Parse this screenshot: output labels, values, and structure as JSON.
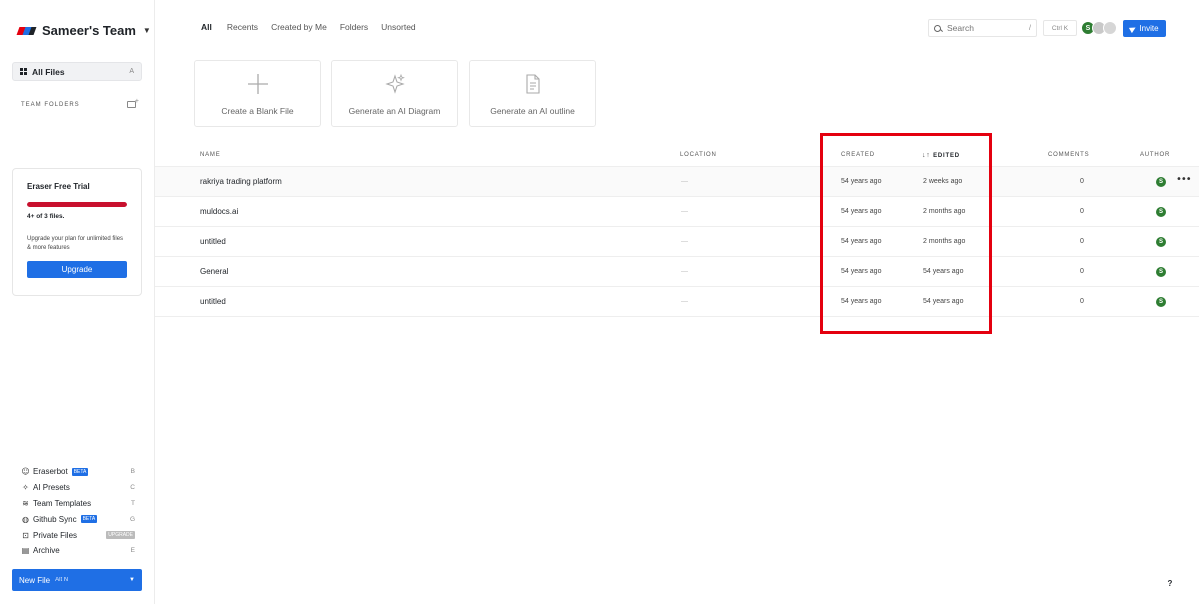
{
  "team": {
    "name": "Sameer's Team"
  },
  "sidebar": {
    "all_files": {
      "label": "All Files",
      "shortcut": "A"
    },
    "team_folders_label": "TEAM FOLDERS",
    "trial": {
      "title": "Eraser Free Trial",
      "usage_fraction": 1.0,
      "count_text": "4+ of 3 files.",
      "description": "Upgrade your plan for unlimited files & more features",
      "upgrade_label": "Upgrade"
    },
    "menu": [
      {
        "label": "Eraserbot",
        "badge": "BETA",
        "shortcut": "B",
        "icon": "robot-icon"
      },
      {
        "label": "AI Presets",
        "badge": "",
        "shortcut": "C",
        "icon": "sparkle-icon"
      },
      {
        "label": "Team Templates",
        "badge": "",
        "shortcut": "T",
        "icon": "layers-icon"
      },
      {
        "label": "Github Sync",
        "badge": "BETA",
        "shortcut": "G",
        "icon": "github-icon"
      },
      {
        "label": "Private Files",
        "badge": "UPGRADE",
        "shortcut": "",
        "icon": "lock-icon"
      },
      {
        "label": "Archive",
        "badge": "",
        "shortcut": "E",
        "icon": "archive-icon"
      }
    ],
    "new_file": {
      "label": "New File",
      "shortcut": "Alt N"
    }
  },
  "tabs": [
    {
      "label": "All",
      "active": true
    },
    {
      "label": "Recents",
      "active": false
    },
    {
      "label": "Created by Me",
      "active": false
    },
    {
      "label": "Folders",
      "active": false
    },
    {
      "label": "Unsorted",
      "active": false
    }
  ],
  "search": {
    "placeholder": "Search",
    "shortcut": "/"
  },
  "command_shortcut": "Ctrl K",
  "avatars": [
    {
      "initial": "S",
      "color": "#2e7d32"
    },
    {
      "initial": "",
      "color": "#c9c9c9"
    },
    {
      "initial": "",
      "color": "#d6d6d6"
    }
  ],
  "invite_label": "Invite",
  "cards": [
    {
      "label": "Create a Blank File",
      "icon": "plus-icon"
    },
    {
      "label": "Generate an AI Diagram",
      "icon": "sparkles-icon"
    },
    {
      "label": "Generate an AI outline",
      "icon": "document-icon"
    }
  ],
  "table": {
    "headers": {
      "name": "NAME",
      "location": "LOCATION",
      "created": "CREATED",
      "edited": "EDITED",
      "comments": "COMMENTS",
      "author": "AUTHOR"
    },
    "rows": [
      {
        "name": "rakriya trading platform",
        "location": "—",
        "created": "54 years ago",
        "edited": "2 weeks ago",
        "comments": "0",
        "author": "S"
      },
      {
        "name": "muldocs.ai",
        "location": "—",
        "created": "54 years ago",
        "edited": "2 months ago",
        "comments": "0",
        "author": "S"
      },
      {
        "name": "untitled",
        "location": "—",
        "created": "54 years ago",
        "edited": "2 months ago",
        "comments": "0",
        "author": "S"
      },
      {
        "name": "General",
        "location": "—",
        "created": "54 years ago",
        "edited": "54 years ago",
        "comments": "0",
        "author": "S"
      },
      {
        "name": "untitled",
        "location": "—",
        "created": "54 years ago",
        "edited": "54 years ago",
        "comments": "0",
        "author": "S"
      }
    ]
  },
  "help_label": "?",
  "colors": {
    "accent": "#1f6fe5",
    "trial_bar": "#c8102e",
    "highlight": "#e4000f",
    "author_avatar": "#2e7d32"
  }
}
